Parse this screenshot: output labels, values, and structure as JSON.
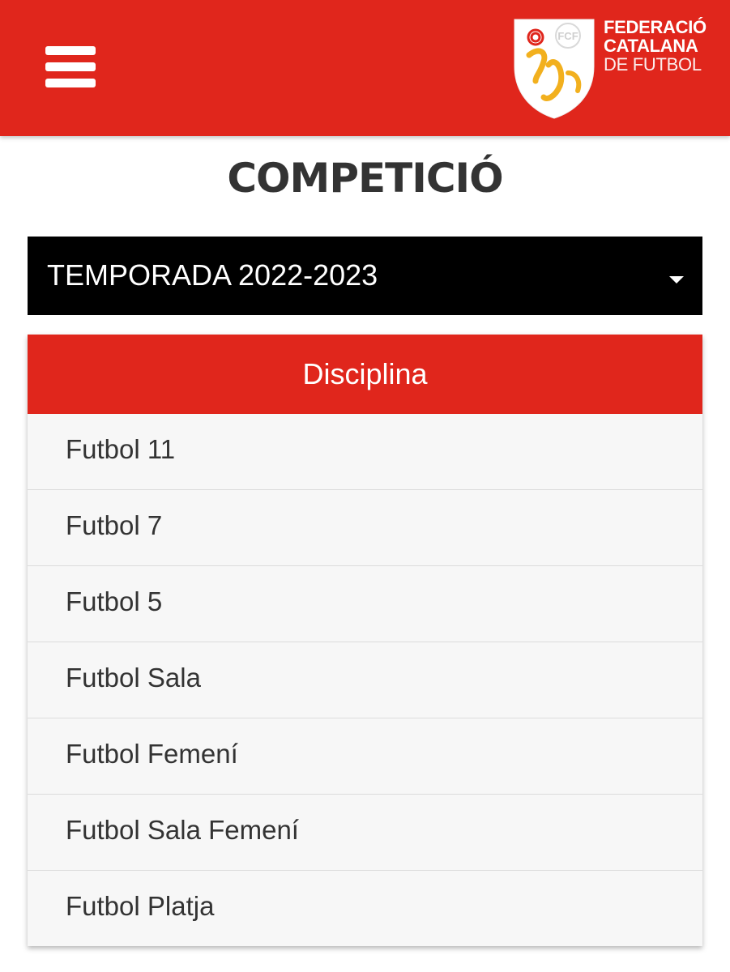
{
  "header": {
    "menu_icon": "hamburger-menu-icon",
    "logo": {
      "crest_text": "FCF",
      "line1": "FEDERACIÓ",
      "line2": "CATALANA",
      "line3": "DE FUTBOL"
    },
    "colors": {
      "brand_red": "#e0261c",
      "crest_gold": "#f2b01e"
    }
  },
  "page": {
    "title": "COMPETICIÓ"
  },
  "season_select": {
    "selected": "TEMPORADA 2022-2023",
    "icon": "caret-down-icon"
  },
  "disciplines": {
    "header": "Disciplina",
    "items": [
      "Futbol 11",
      "Futbol 7",
      "Futbol 5",
      "Futbol Sala",
      "Futbol Femení",
      "Futbol Sala Femení",
      "Futbol Platja"
    ]
  }
}
